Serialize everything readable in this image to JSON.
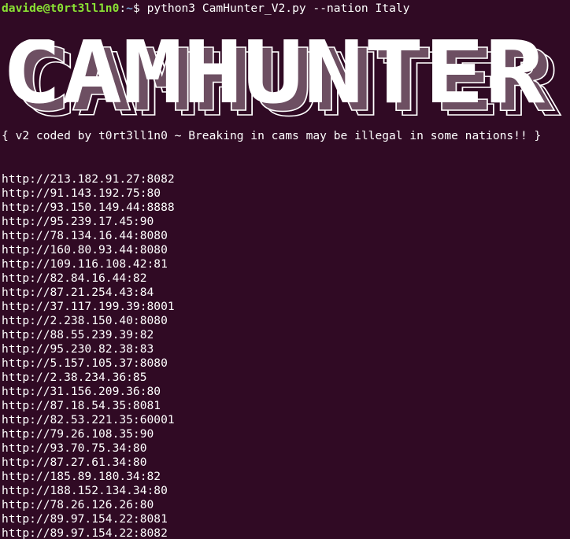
{
  "prompt": {
    "user_host": "davide@t0rt3ll1n0",
    "separator": ":",
    "path": "~",
    "symbol": "$",
    "command": "python3 CamHunter_V2.py --nation Italy"
  },
  "banner": {
    "text": "CAMHUNTER",
    "colors": {
      "fill": "#ffffff",
      "shadow": "#6d4f62",
      "outline": "#ffffff"
    }
  },
  "tagline": "{ v2 coded by t0rt3ll1n0 ~ Breaking in cams may be illegal in some nations!! }",
  "urls": [
    "http://213.182.91.27:8082",
    "http://91.143.192.75:80",
    "http://93.150.149.44:8888",
    "http://95.239.17.45:90",
    "http://78.134.16.44:8080",
    "http://160.80.93.44:8080",
    "http://109.116.108.42:81",
    "http://82.84.16.44:82",
    "http://87.21.254.43:84",
    "http://37.117.199.39:8001",
    "http://2.238.150.40:8080",
    "http://88.55.239.39:82",
    "http://95.230.82.38:83",
    "http://5.157.105.37:8080",
    "http://2.38.234.36:85",
    "http://31.156.209.36:80",
    "http://87.18.54.35:8081",
    "http://82.53.221.35:60001",
    "http://79.26.108.35:90",
    "http://93.70.75.34:80",
    "http://87.27.61.34:80",
    "http://185.89.180.34:82",
    "http://188.152.134.34:80",
    "http://78.26.126.26:80",
    "http://89.97.154.22:8081",
    "http://89.97.154.22:8082"
  ],
  "theme": {
    "background": "#300a24",
    "foreground": "#ffffff",
    "user_color": "#8ae234",
    "path_color": "#729fcf"
  }
}
